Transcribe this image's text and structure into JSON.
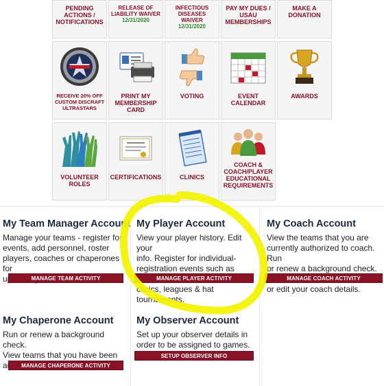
{
  "tiles_top": [
    {
      "label": "PENDING\nACTIONS /\nNOTIFICATIONS",
      "date": ""
    },
    {
      "label": "RELEASE OF\nLIABILITY WAIVER",
      "date": "12/31/2020"
    },
    {
      "label": "INFECTIOUS\nDISEASES WAIVER",
      "date": "12/31/2020"
    },
    {
      "label": "PAY MY DUES /\nUSAU\nMEMBERSHIPS",
      "date": ""
    },
    {
      "label": "MAKE A\nDONATION",
      "date": ""
    }
  ],
  "tiles_mid": [
    {
      "label": "RECEIVE 20% OFF\nCUSTOM DISCRAFT\nULTRASTARS",
      "icon": "discraft-disc-icon"
    },
    {
      "label": "PRINT MY\nMEMBERSHIP\nCARD",
      "icon": "printer-card-icon"
    },
    {
      "label": "VOTING",
      "icon": "thumbs-up-down-icon"
    },
    {
      "label": "EVENT\nCALENDAR",
      "icon": "calendar-icon"
    },
    {
      "label": "AWARDS",
      "icon": "trophy-icon"
    }
  ],
  "tiles_bottom": [
    {
      "label": "VOLUNTEER\nROLES",
      "icon": "raised-hands-icon"
    },
    {
      "label": "CERTIFICATIONS",
      "icon": "certificate-icon"
    },
    {
      "label": "CLINICS",
      "icon": "notepad-icon"
    },
    {
      "label": "COACH &\nCOACH/PLAYER\nEDUCATIONAL\nREQUIREMENTS",
      "icon": "people-group-icon"
    }
  ],
  "accounts": {
    "team_manager": {
      "title": "My Team Manager Account",
      "desc": "Manage your teams - register for\nevents, add personnel, roster\nplayers, coaches or chaperones for\nupcoming events.",
      "button": "MANAGE TEAM ACTIVITY"
    },
    "player": {
      "title": "My Player Account",
      "desc": "View your player history. Edit your\ninfo. Register for individual-\nregistration events such as camps,\nclinics, leagues & hat tournaments.",
      "button": "MANAGE PLAYER ACTIVITY"
    },
    "coach": {
      "title": "My Coach Account",
      "desc": "View the teams that you are\ncurrently authorized to coach. Run\nor renew a background check. View\nor edit your coach details.",
      "button": "MANAGE COACH ACTIVITY"
    },
    "chaperone": {
      "title": "My Chaperone Account",
      "desc": "Run or renew a background check.\nView teams that you have been\nauthorized to chaperone.",
      "button": "MANAGE CHAPERONE ACTIVITY"
    },
    "observer": {
      "title": "My Observer Account",
      "desc": "Set up your observer details in\norder to be assigned to games.",
      "button": "SETUP OBSERVER INFO"
    }
  },
  "colors": {
    "accent": "#8a1226",
    "highlight": "#f2f200",
    "date_green": "#2f8a2f"
  }
}
